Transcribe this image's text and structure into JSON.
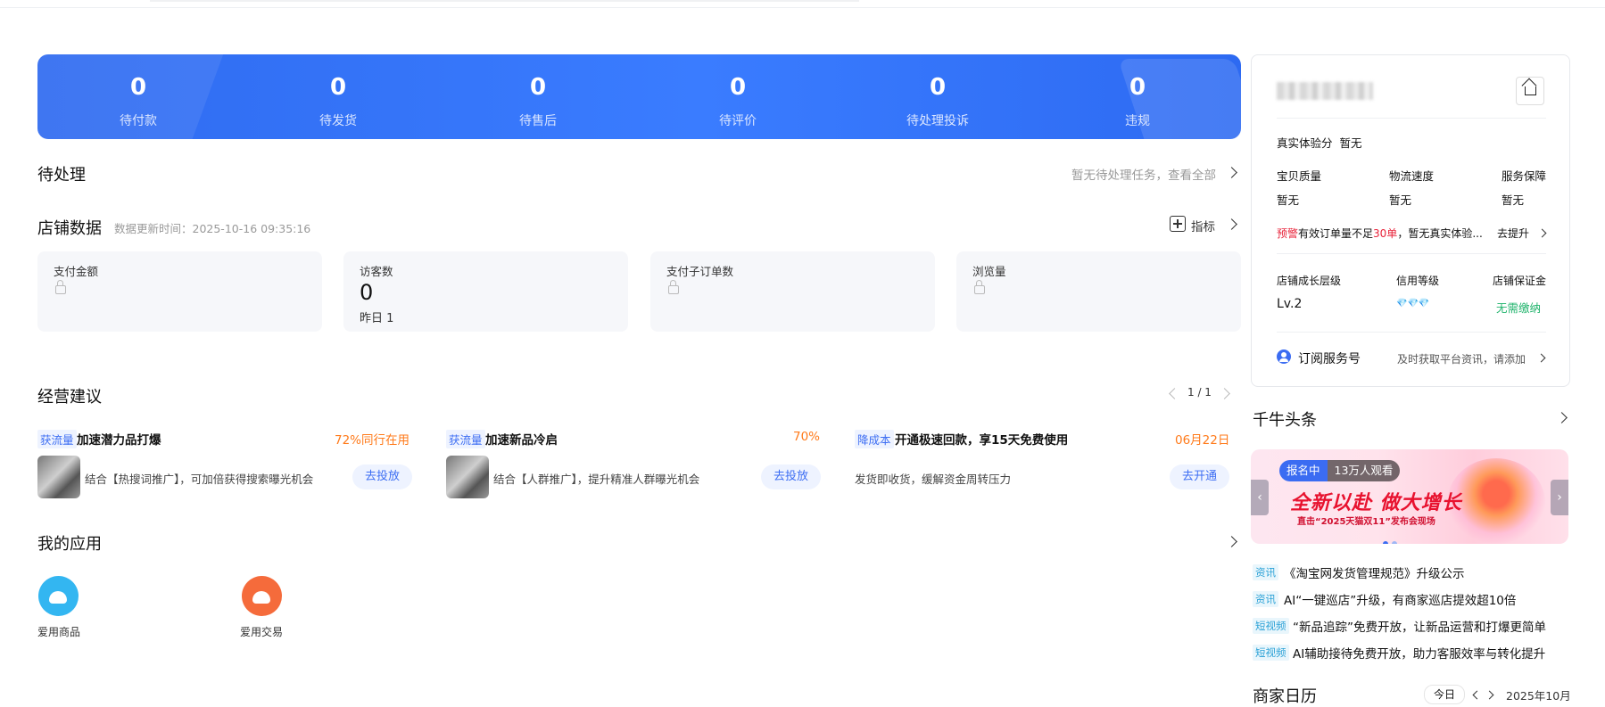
{
  "stats": [
    {
      "value": "0",
      "label": "待付款"
    },
    {
      "value": "0",
      "label": "待发货"
    },
    {
      "value": "0",
      "label": "待售后"
    },
    {
      "value": "0",
      "label": "待评价"
    },
    {
      "value": "0",
      "label": "待处理投诉"
    },
    {
      "value": "0",
      "label": "违规"
    }
  ],
  "pending": {
    "title": "待处理",
    "hint": "暂无待处理任务，查看全部"
  },
  "store_data": {
    "title": "店铺数据",
    "updated": "数据更新时间：2025-10-16 09:35:16",
    "indicator_label": "指标",
    "cards": [
      {
        "title": "支付金额"
      },
      {
        "title": "访客数",
        "value": "0",
        "yesterday": "昨日 1"
      },
      {
        "title": "支付子订单数"
      },
      {
        "title": "浏览量"
      }
    ]
  },
  "advice": {
    "title": "经营建议",
    "pager": "1 / 1",
    "items": [
      {
        "tag": "获流量",
        "title": "加速潜力品打爆",
        "stat": "72%同行在用",
        "desc": "结合【热搜词推广】，可加倍获得搜索曝光机会",
        "action": "去投放"
      },
      {
        "tag": "获流量",
        "title": "加速新品冷启",
        "stat": "70%",
        "desc": "结合【人群推广】，提升精准人群曝光机会",
        "action": "去投放"
      },
      {
        "tag": "降成本",
        "title": "开通极速回款，享15天免费使用",
        "stat": "06月22日",
        "desc": "发货即收货，缓解资金周转压力",
        "action": "去开通"
      }
    ]
  },
  "apps": {
    "title": "我的应用",
    "items": [
      {
        "label": "爱用商品",
        "color": "#33b6f1"
      },
      {
        "label": "爱用交易",
        "color": "#f56b3b"
      }
    ]
  },
  "shop_panel": {
    "experience": "真实体验分",
    "experience_value": "暂无",
    "metrics": [
      {
        "label": "宝贝质量",
        "value": "暂无"
      },
      {
        "label": "物流速度",
        "value": "暂无"
      },
      {
        "label": "服务保障",
        "value": "暂无"
      }
    ],
    "warning_tag": "预警",
    "warning_pre": "有效订单量不足",
    "warning_num": "30单",
    "warning_post": "，暂无真实体验...",
    "warning_action": "去提升",
    "growth_label": "店铺成长层级",
    "growth_value": "Lv.2",
    "credit_label": "信用等级",
    "credit_value": "💎💎💎",
    "deposit_label": "店铺保证金",
    "deposit_value": "无需缴纳",
    "subscribe_label": "订阅服务号",
    "subscribe_hint": "及时获取平台资讯，请添加"
  },
  "headlines": {
    "title": "千牛头条",
    "banner_status": "报名中",
    "banner_viewers": "13万人观看",
    "banner_main": "全新以赴 做大增长",
    "banner_sub": "直击“2025天猫双11”发布会现场",
    "news": [
      {
        "tag": "资讯",
        "text": "《淘宝网发货管理规范》升级公示"
      },
      {
        "tag": "资讯",
        "text": "AI“一键巡店”升级，有商家巡店提效超10倍"
      },
      {
        "tag": "短视频",
        "text": "“新品追踪”免费开放，让新品运营和打爆更简单"
      },
      {
        "tag": "短视频",
        "text": "AI辅助接待免费开放，助力客服效率与转化提升"
      }
    ]
  },
  "calendar": {
    "title": "商家日历",
    "today": "今日",
    "month": "2025年10月"
  }
}
